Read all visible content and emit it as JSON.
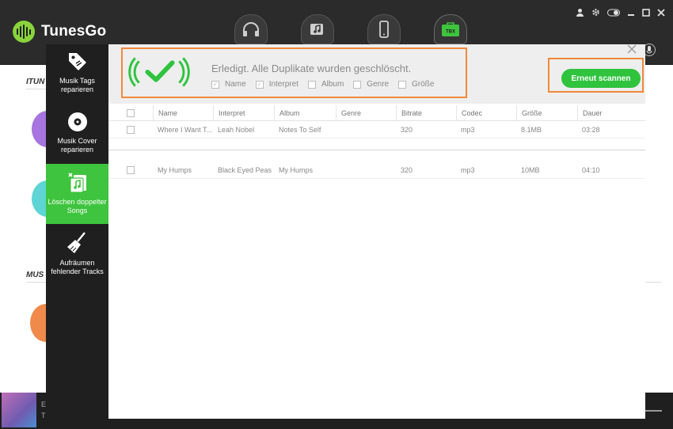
{
  "app": {
    "name": "TunesGo"
  },
  "topnav": [
    {
      "name": "headphones-icon",
      "label": ""
    },
    {
      "name": "music-video-icon",
      "label": ""
    },
    {
      "name": "phone-icon",
      "label": ""
    },
    {
      "name": "toolbox-icon",
      "label": "TBX"
    }
  ],
  "background": {
    "section1": "ITUN",
    "section2": "MUS"
  },
  "player": {
    "line1": "E",
    "line2": "T"
  },
  "sidebar": {
    "items": [
      {
        "label": "Musik Tags reparieren",
        "icon": "tag-icon"
      },
      {
        "label": "Musik Cover reparieren",
        "icon": "disc-icon"
      },
      {
        "label": "Löschen doppelter Songs",
        "icon": "duplicate-music-icon"
      },
      {
        "label": "Aufräumen fehlender Tracks",
        "icon": "broom-icon"
      }
    ]
  },
  "notify": {
    "message": "Erledigt. Alle Duplikate wurden geschlöscht.",
    "criteria": [
      {
        "label": "Name",
        "checked": true
      },
      {
        "label": "Interpret",
        "checked": true
      },
      {
        "label": "Album",
        "checked": false
      },
      {
        "label": "Genre",
        "checked": false
      },
      {
        "label": "Größe",
        "checked": false
      }
    ],
    "rescan_label": "Erneut scannen"
  },
  "table": {
    "columns": [
      "Name",
      "Interpret",
      "Album",
      "Genre",
      "Bitrate",
      "Codec",
      "Größe",
      "Dauer"
    ],
    "rows": [
      {
        "name": "Where I Want T...",
        "artist": "Leah Nobel",
        "album": "Notes To Self",
        "genre": "",
        "bitrate": "320",
        "codec": "mp3",
        "size": "8.1MB",
        "duration": "03:28"
      },
      {
        "name": "My Humps",
        "artist": "Black Eyed Peas",
        "album": "My Humps",
        "genre": "",
        "bitrate": "320",
        "codec": "mp3",
        "size": "10MB",
        "duration": "04:10"
      }
    ]
  },
  "colors": {
    "accent_green": "#2fc33e",
    "sidebar_active": "#3ec43e",
    "highlight_orange": "#f0883a"
  }
}
